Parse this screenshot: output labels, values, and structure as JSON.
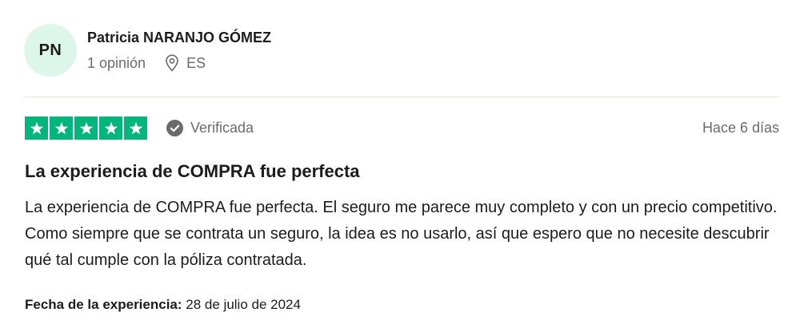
{
  "reviewer": {
    "initials": "PN",
    "name": "Patricia NARANJO GÓMEZ",
    "reviews_count": "1 opinión",
    "country": "ES"
  },
  "review": {
    "rating": 5,
    "rating_max": 5,
    "verified_label": "Verificada",
    "date": "Hace 6 días",
    "title": "La experiencia de COMPRA fue perfecta",
    "body": "La experiencia de COMPRA fue perfecta. El seguro me parece muy completo y con un precio competitivo. Como siempre que se contrata un seguro, la idea es no usarlo, así que espero que no necesite descubrir qué tal cumple con la póliza contratada.",
    "experience_date_label": "Fecha de la experiencia:",
    "experience_date": "28 de julio de 2024"
  },
  "colors": {
    "star_fill": "#00b67a",
    "avatar_bg": "#dcf6ea",
    "muted_text": "#6b6b6b"
  },
  "icons": {
    "location": "map-pin-icon",
    "verified": "check-circle-icon",
    "star": "star-icon"
  }
}
